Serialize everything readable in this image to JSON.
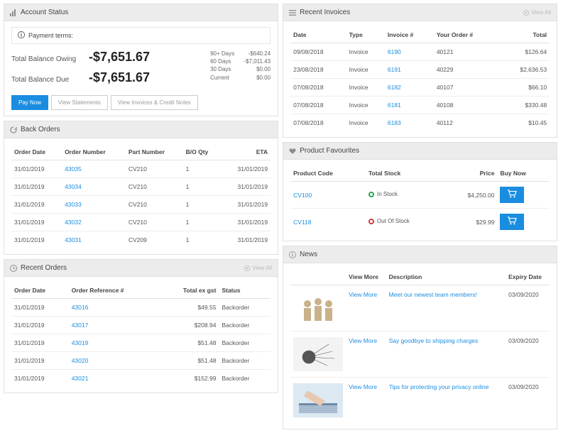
{
  "account_status": {
    "title": "Account Status",
    "payment_terms_label": "Payment terms:",
    "balance_owing_label": "Total Balance Owing",
    "balance_owing_value": "-$7,651.67",
    "balance_due_label": "Total Balance Due",
    "balance_due_value": "-$7,651.67",
    "aging": [
      {
        "label": "90+ Days",
        "value": "-$640.24"
      },
      {
        "label": "60 Days",
        "value": "-$7,011.43"
      },
      {
        "label": "30 Days",
        "value": "$0.00"
      },
      {
        "label": "Current",
        "value": "$0.00"
      }
    ],
    "buttons": {
      "pay_now": "Pay Now",
      "view_statements": "View Statements",
      "view_invoices_credit": "View Invoices & Credit Notes"
    }
  },
  "back_orders": {
    "title": "Back Orders",
    "headers": {
      "date": "Order Date",
      "num": "Order Number",
      "part": "Part Number",
      "qty": "B/O Qty",
      "eta": "ETA"
    },
    "rows": [
      {
        "date": "31/01/2019",
        "num": "43035",
        "part": "CV210",
        "qty": "1",
        "eta": "31/01/2019"
      },
      {
        "date": "31/01/2019",
        "num": "43034",
        "part": "CV210",
        "qty": "1",
        "eta": "31/01/2019"
      },
      {
        "date": "31/01/2019",
        "num": "43033",
        "part": "CV210",
        "qty": "1",
        "eta": "31/01/2019"
      },
      {
        "date": "31/01/2019",
        "num": "43032",
        "part": "CV210",
        "qty": "1",
        "eta": "31/01/2019"
      },
      {
        "date": "31/01/2019",
        "num": "43031",
        "part": "CV209",
        "qty": "1",
        "eta": "31/01/2019"
      }
    ]
  },
  "recent_orders": {
    "title": "Recent Orders",
    "view_all": "View All",
    "headers": {
      "date": "Order Date",
      "ref": "Order Reference #",
      "total": "Total ex gst",
      "status": "Status"
    },
    "rows": [
      {
        "date": "31/01/2019",
        "ref": "43016",
        "total": "$49.55",
        "status": "Backorder"
      },
      {
        "date": "31/01/2019",
        "ref": "43017",
        "total": "$208.94",
        "status": "Backorder"
      },
      {
        "date": "31/01/2019",
        "ref": "43019",
        "total": "$51.48",
        "status": "Backorder"
      },
      {
        "date": "31/01/2019",
        "ref": "43020",
        "total": "$51.48",
        "status": "Backorder"
      },
      {
        "date": "31/01/2019",
        "ref": "43021",
        "total": "$152.99",
        "status": "Backorder"
      }
    ]
  },
  "recent_invoices": {
    "title": "Recent Invoices",
    "view_all": "View All",
    "headers": {
      "date": "Date",
      "type": "Type",
      "inv": "Invoice #",
      "order": "Your Order #",
      "total": "Total"
    },
    "rows": [
      {
        "date": "09/08/2018",
        "type": "Invoice",
        "inv": "6190",
        "order": "40121",
        "total": "$126.64"
      },
      {
        "date": "23/08/2018",
        "type": "Invoice",
        "inv": "6191",
        "order": "40229",
        "total": "$2,636.53"
      },
      {
        "date": "07/08/2018",
        "type": "Invoice",
        "inv": "6182",
        "order": "40107",
        "total": "$66.10"
      },
      {
        "date": "07/08/2018",
        "type": "Invoice",
        "inv": "6181",
        "order": "40108",
        "total": "$330.48"
      },
      {
        "date": "07/08/2018",
        "type": "Invoice",
        "inv": "6183",
        "order": "40112",
        "total": "$10.45"
      }
    ]
  },
  "favourites": {
    "title": "Product Favourites",
    "headers": {
      "code": "Product Code",
      "stock": "Total Stock",
      "price": "Price",
      "buy": "Buy Now"
    },
    "rows": [
      {
        "code": "CV100",
        "stock_label": "In Stock",
        "stock_state": "in",
        "price": "$4,250.00"
      },
      {
        "code": "CV118",
        "stock_label": "Out Of Stock",
        "stock_state": "out",
        "price": "$29.99"
      }
    ]
  },
  "news": {
    "title": "News",
    "headers": {
      "viewmore": "View More",
      "desc": "Description",
      "expiry": "Expiry Date"
    },
    "view_more_label": "View More",
    "rows": [
      {
        "desc": "Meet our newest team members!",
        "expiry": "03/09/2020"
      },
      {
        "desc": "Say goodbye to shipping charges",
        "expiry": "03/09/2020"
      },
      {
        "desc": "Tips for protecting your privacy online",
        "expiry": "03/09/2020"
      }
    ]
  }
}
